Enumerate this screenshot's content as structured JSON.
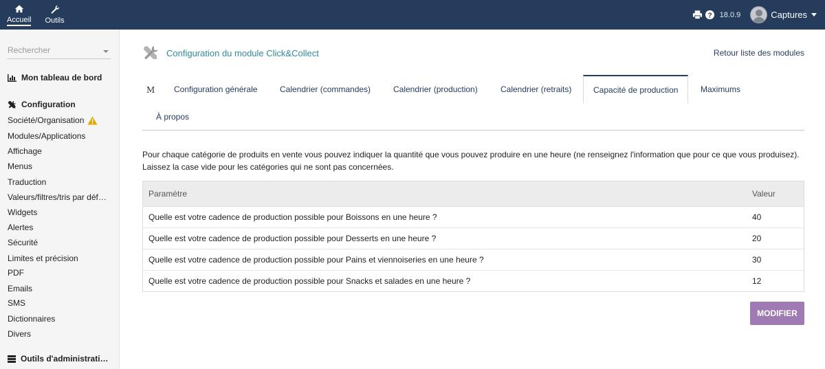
{
  "topbar": {
    "nav": [
      {
        "label": "Accueil",
        "icon": "home-icon",
        "active": true
      },
      {
        "label": "Outils",
        "icon": "wrench-icon",
        "active": false
      }
    ],
    "version": "18.0.9",
    "user": "Captures"
  },
  "sidebar": {
    "search_placeholder": "Rechercher",
    "dashboard": "Mon tableau de bord",
    "configuration": "Configuration",
    "items": [
      "Société/Organisation",
      "Modules/Applications",
      "Affichage",
      "Menus",
      "Traduction",
      "Valeurs/filtres/tris par déf…",
      "Widgets",
      "Alertes",
      "Sécurité",
      "Limites et précision",
      "PDF",
      "Emails",
      "SMS",
      "Dictionnaires",
      "Divers"
    ],
    "admin_tools": "Outils d'administrati…"
  },
  "main": {
    "title": "Configuration du module Click&Collect",
    "back_link": "Retour liste des modules",
    "tab_prefix": "M",
    "tabs": [
      "Configuration générale",
      "Calendrier (commandes)",
      "Calendrier (production)",
      "Calendrier (retraits)",
      "Capacité de production",
      "Maximums",
      "À propos"
    ],
    "active_tab": "Capacité de production",
    "intro": "Pour chaque catégorie de produits en vente vous pouvez indiquer la quantité que vous pouvez produire en une heure (ne renseignez l'information que pour ce que vous produisez). Laissez la case vide pour les catégories qui ne sont pas concernées.",
    "table": {
      "headers": [
        "Paramètre",
        "Valeur"
      ],
      "rows": [
        {
          "param": "Quelle est votre cadence de production possible pour Boissons en une heure ?",
          "value": "40"
        },
        {
          "param": "Quelle est votre cadence de production possible pour Desserts en une heure ?",
          "value": "20"
        },
        {
          "param": "Quelle est votre cadence de production possible pour Pains et viennoiseries en une heure ?",
          "value": "30"
        },
        {
          "param": "Quelle est votre cadence de production possible pour Snacks et salades en une heure ?",
          "value": "12"
        }
      ]
    },
    "modify_button": "MODIFIER"
  },
  "colors": {
    "topbar": "#263c5c",
    "accent": "#2e8b9a",
    "button": "#a07bb3",
    "warning": "#e0a800"
  }
}
